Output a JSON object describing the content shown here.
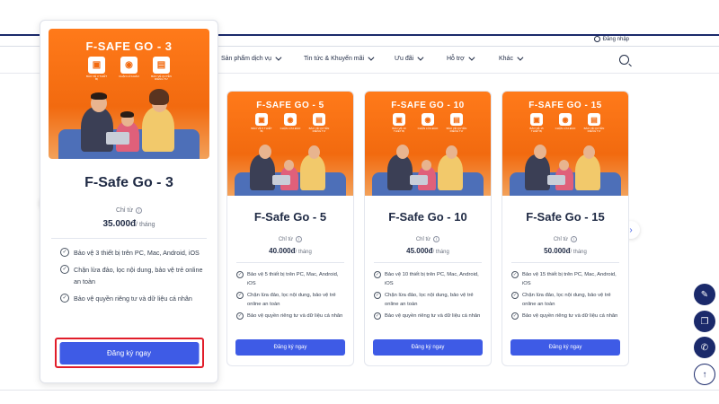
{
  "header": {
    "login_label": "Đăng nhập",
    "nav": [
      {
        "label": "Sản phẩm dịch vụ"
      },
      {
        "label": "Tin tức & Khuyến mãi"
      },
      {
        "label": "Ưu đãi"
      },
      {
        "label": "Hỗ trợ"
      },
      {
        "label": "Khác"
      }
    ]
  },
  "carousel": {
    "prev_icon": "chevron-left-icon",
    "next_icon": "chevron-right-icon"
  },
  "plans": [
    {
      "banner_title": "F-SAFE GO - 3",
      "features": [
        "BẢO VỆ 3 THIẾT BỊ",
        "CHẶN LỪA ĐẢO",
        "BẢO VỆ QUYỀN RIÊNG TƯ"
      ],
      "name": "F-Safe Go - 3",
      "from_label": "Chỉ từ",
      "price": "35.000đ",
      "per": "/ tháng",
      "benefits": [
        "Bảo vệ 3 thiết bị trên PC, Mac, Android, iOS",
        "Chặn lừa đảo, lọc nội dung, bảo vệ trẻ online an toàn",
        "Bảo vệ quyền riêng tư và dữ liệu cá nhân"
      ],
      "cta": "Đăng ký ngay"
    },
    {
      "banner_title": "F-SAFE GO - 5",
      "features": [
        "BẢO VỆ 5 THIẾT BỊ",
        "CHẶN LỪA ĐẢO",
        "BẢO VỆ QUYỀN RIÊNG TƯ"
      ],
      "name": "F-Safe Go - 5",
      "from_label": "Chỉ từ",
      "price": "40.000đ",
      "per": "/ tháng",
      "benefits": [
        "Bảo vệ 5 thiết bị trên PC, Mac, Android, iOS",
        "Chặn lừa đảo, lọc nội dung, bảo vệ trẻ online an toàn",
        "Bảo vệ quyền riêng tư và dữ liệu cá nhân"
      ],
      "cta": "Đăng ký ngay"
    },
    {
      "banner_title": "F-SAFE GO - 10",
      "features": [
        "BẢO VỆ 10 THIẾT BỊ",
        "CHẶN LỪA ĐẢO",
        "BẢO VỆ QUYỀN RIÊNG TƯ"
      ],
      "name": "F-Safe Go - 10",
      "from_label": "Chỉ từ",
      "price": "45.000đ",
      "per": "/ tháng",
      "benefits": [
        "Bảo vệ 10 thiết bị trên PC, Mac, Android, iOS",
        "Chặn lừa đảo, lọc nội dung, bảo vệ trẻ online an toàn",
        "Bảo vệ quyền riêng tư và dữ liệu cá nhân"
      ],
      "cta": "Đăng ký ngay"
    },
    {
      "banner_title": "F-SAFE GO - 15",
      "features": [
        "BẢO VỆ 15 THIẾT BỊ",
        "CHẶN LỪA ĐẢO",
        "BẢO VỆ QUYỀN RIÊNG TƯ"
      ],
      "name": "F-Safe Go - 15",
      "from_label": "Chỉ từ",
      "price": "50.000đ",
      "per": "/ tháng",
      "benefits": [
        "Bảo vệ 15 thiết bị trên PC, Mac, Android, iOS",
        "Chặn lừa đảo, lọc nội dung, bảo vệ trẻ online an toàn",
        "Bảo vệ quyền riêng tư và dữ liệu cá nhân"
      ],
      "cta": "Đăng ký ngay"
    }
  ],
  "floating_actions": [
    {
      "icon": "chat-icon"
    },
    {
      "icon": "messages-icon"
    },
    {
      "icon": "phone-icon"
    },
    {
      "icon": "arrow-up-icon"
    }
  ],
  "colors": {
    "brand_navy": "#1b2a6b",
    "cta_blue": "#3e5be6",
    "banner_orange": "#f26a0f",
    "highlight_red": "#e11d2a"
  }
}
